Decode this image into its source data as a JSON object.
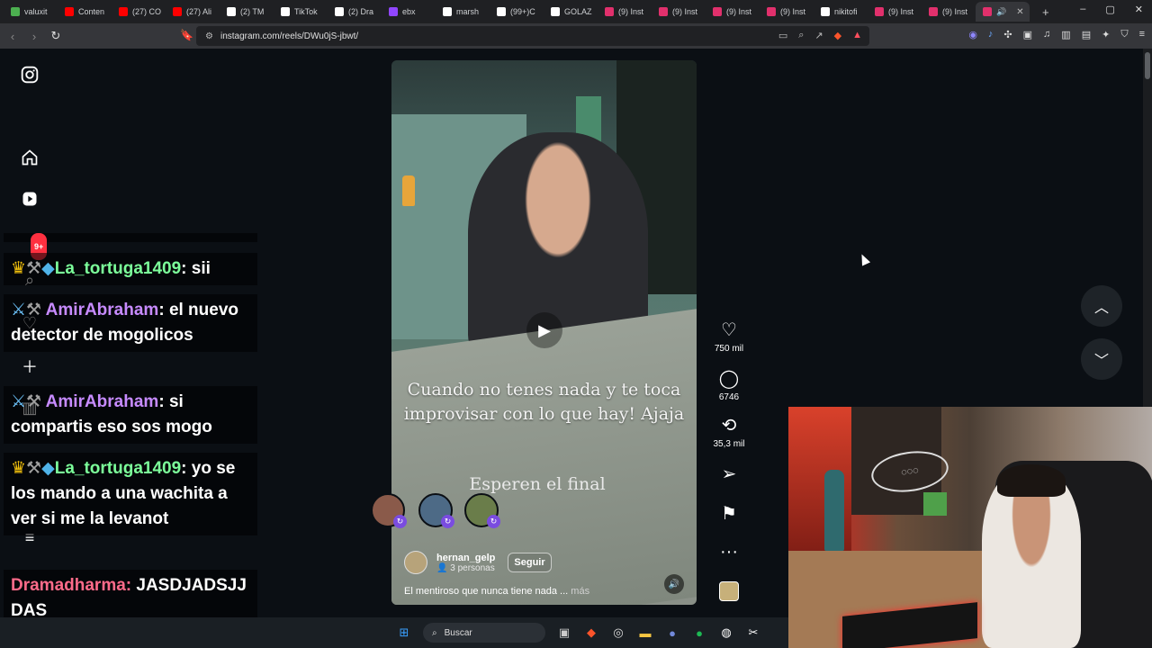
{
  "browser": {
    "tabs": [
      {
        "label": "valuxit",
        "color": "#4caf50"
      },
      {
        "label": "Conten",
        "color": "#ff0000"
      },
      {
        "label": "(27) CO",
        "color": "#ff0000"
      },
      {
        "label": "(27) Ali",
        "color": "#ff0000"
      },
      {
        "label": "(2) TM",
        "color": "#ffffff"
      },
      {
        "label": "TikTok",
        "color": "#ffffff"
      },
      {
        "label": "(2) Dra",
        "color": "#ffffff"
      },
      {
        "label": "ebx",
        "color": "#9146ff"
      },
      {
        "label": "marsh",
        "color": "#ffffff"
      },
      {
        "label": "(99+)C",
        "color": "#ffffff"
      },
      {
        "label": "GOLAZ",
        "color": "#ffffff"
      },
      {
        "label": "(9) Inst",
        "color": "#e1306c"
      },
      {
        "label": "(9) Inst",
        "color": "#e1306c"
      },
      {
        "label": "(9) Inst",
        "color": "#e1306c"
      },
      {
        "label": "(9) Inst",
        "color": "#e1306c"
      },
      {
        "label": "nikitofi",
        "color": "#ffffff"
      },
      {
        "label": "(9) Inst",
        "color": "#e1306c"
      },
      {
        "label": "(9) Inst",
        "color": "#e1306c"
      }
    ],
    "url": "instagram.com/reels/DWu0jS-jbwt/"
  },
  "chat": {
    "notification_count": "9+",
    "messages": [
      {
        "user": "La_tortuga1409",
        "sep": ":",
        "text": "sii",
        "color": "#7cff9a"
      },
      {
        "user": "AmirAbraham",
        "sep": ":",
        "text": "el nuevo detector de mogolicos",
        "color": "#c78bff"
      },
      {
        "user": "AmirAbraham",
        "sep": ":",
        "text": "si compartis eso sos mogo",
        "color": "#c78bff"
      },
      {
        "user": "La_tortuga1409",
        "sep": ":",
        "text": "yo se los mando a una wachita a ver si me la levanot",
        "color": "#7cff9a"
      },
      {
        "user": "Dramadharma",
        "sep": ":",
        "text": "JASDJADSJJDAS",
        "color": "#ff6b8a"
      }
    ]
  },
  "reel": {
    "caption": "Cuando no tenes nada y te toca improvisar con lo que hay! Ajaja",
    "caption2": "Esperen el final",
    "author": "hernan_gelp",
    "author_sub": "3 personas",
    "follow_label": "Seguir",
    "description": "El mentiroso que nunca tiene nada ...",
    "more_label": "más",
    "likes": "750 mil",
    "comments": "6746",
    "reposts": "35,3 mil"
  },
  "taskbar": {
    "search_placeholder": "Buscar"
  }
}
